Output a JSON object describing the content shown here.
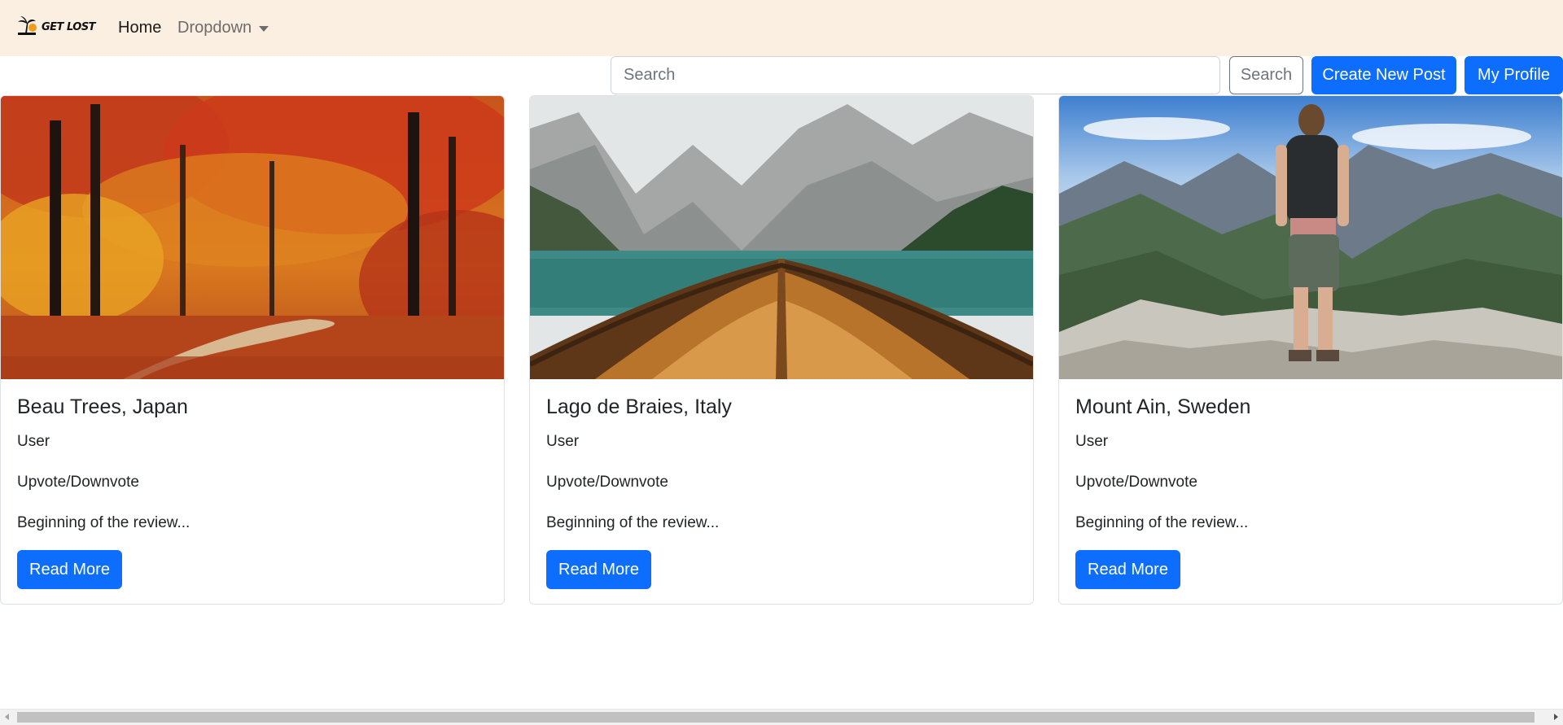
{
  "brand": {
    "name": "GET LOST",
    "logo_icon": "palm-tree-icon"
  },
  "nav": {
    "home": "Home",
    "dropdown": "Dropdown"
  },
  "search": {
    "placeholder": "Search",
    "button": "Search"
  },
  "actions": {
    "create_post": "Create New Post",
    "my_profile": "My Profile"
  },
  "colors": {
    "navbar_bg": "#faefe0",
    "primary": "#0d6efd"
  },
  "cards": [
    {
      "title": "Beau Trees, Japan",
      "user": "User",
      "vote": "Upvote/Downvote",
      "review": "Beginning of the review...",
      "button": "Read More",
      "image": "autumn-forest-path"
    },
    {
      "title": "Lago de Braies, Italy",
      "user": "User",
      "vote": "Upvote/Downvote",
      "review": "Beginning of the review...",
      "button": "Read More",
      "image": "boat-on-mountain-lake"
    },
    {
      "title": "Mount Ain, Sweden",
      "user": "User",
      "vote": "Upvote/Downvote",
      "review": "Beginning of the review...",
      "button": "Read More",
      "image": "hiker-on-mountain"
    }
  ]
}
